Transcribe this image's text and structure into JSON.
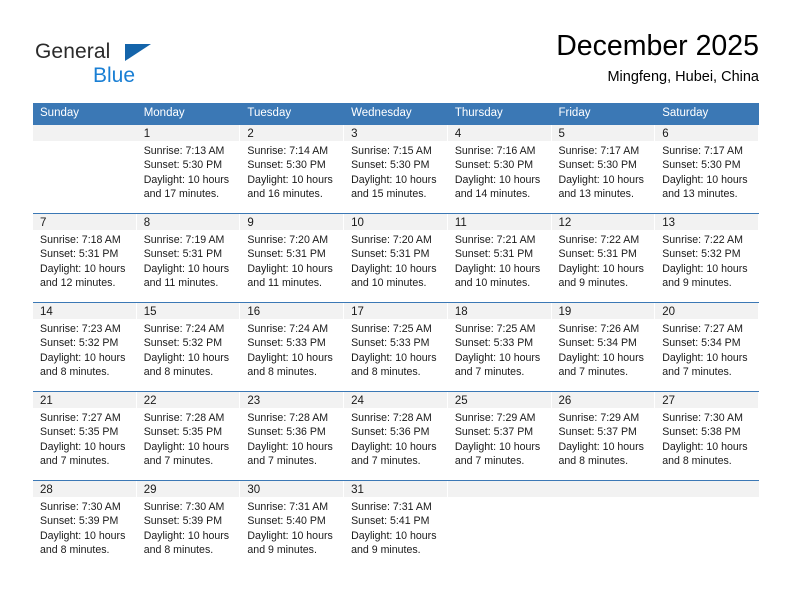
{
  "brand": {
    "name_top": "General",
    "name_bottom": "Blue",
    "accent_color": "#1a7fd4",
    "triangle_color": "#1464aa"
  },
  "header": {
    "title": "December 2025",
    "subtitle": "Mingfeng, Hubei, China"
  },
  "theme": {
    "header_row_bg": "#3b78b5",
    "daynum_band_bg": "#f2f2f2",
    "cell_bg": "#ffffff",
    "text_color": "#1a1a1a"
  },
  "calendar": {
    "daynames": [
      "Sunday",
      "Monday",
      "Tuesday",
      "Wednesday",
      "Thursday",
      "Friday",
      "Saturday"
    ],
    "weeks": [
      [
        {
          "day": "",
          "sunrise": "",
          "sunset": "",
          "daylight_1": "",
          "daylight_2": ""
        },
        {
          "day": "1",
          "sunrise": "Sunrise: 7:13 AM",
          "sunset": "Sunset: 5:30 PM",
          "daylight_1": "Daylight: 10 hours",
          "daylight_2": "and 17 minutes."
        },
        {
          "day": "2",
          "sunrise": "Sunrise: 7:14 AM",
          "sunset": "Sunset: 5:30 PM",
          "daylight_1": "Daylight: 10 hours",
          "daylight_2": "and 16 minutes."
        },
        {
          "day": "3",
          "sunrise": "Sunrise: 7:15 AM",
          "sunset": "Sunset: 5:30 PM",
          "daylight_1": "Daylight: 10 hours",
          "daylight_2": "and 15 minutes."
        },
        {
          "day": "4",
          "sunrise": "Sunrise: 7:16 AM",
          "sunset": "Sunset: 5:30 PM",
          "daylight_1": "Daylight: 10 hours",
          "daylight_2": "and 14 minutes."
        },
        {
          "day": "5",
          "sunrise": "Sunrise: 7:17 AM",
          "sunset": "Sunset: 5:30 PM",
          "daylight_1": "Daylight: 10 hours",
          "daylight_2": "and 13 minutes."
        },
        {
          "day": "6",
          "sunrise": "Sunrise: 7:17 AM",
          "sunset": "Sunset: 5:30 PM",
          "daylight_1": "Daylight: 10 hours",
          "daylight_2": "and 13 minutes."
        }
      ],
      [
        {
          "day": "7",
          "sunrise": "Sunrise: 7:18 AM",
          "sunset": "Sunset: 5:31 PM",
          "daylight_1": "Daylight: 10 hours",
          "daylight_2": "and 12 minutes."
        },
        {
          "day": "8",
          "sunrise": "Sunrise: 7:19 AM",
          "sunset": "Sunset: 5:31 PM",
          "daylight_1": "Daylight: 10 hours",
          "daylight_2": "and 11 minutes."
        },
        {
          "day": "9",
          "sunrise": "Sunrise: 7:20 AM",
          "sunset": "Sunset: 5:31 PM",
          "daylight_1": "Daylight: 10 hours",
          "daylight_2": "and 11 minutes."
        },
        {
          "day": "10",
          "sunrise": "Sunrise: 7:20 AM",
          "sunset": "Sunset: 5:31 PM",
          "daylight_1": "Daylight: 10 hours",
          "daylight_2": "and 10 minutes."
        },
        {
          "day": "11",
          "sunrise": "Sunrise: 7:21 AM",
          "sunset": "Sunset: 5:31 PM",
          "daylight_1": "Daylight: 10 hours",
          "daylight_2": "and 10 minutes."
        },
        {
          "day": "12",
          "sunrise": "Sunrise: 7:22 AM",
          "sunset": "Sunset: 5:31 PM",
          "daylight_1": "Daylight: 10 hours",
          "daylight_2": "and 9 minutes."
        },
        {
          "day": "13",
          "sunrise": "Sunrise: 7:22 AM",
          "sunset": "Sunset: 5:32 PM",
          "daylight_1": "Daylight: 10 hours",
          "daylight_2": "and 9 minutes."
        }
      ],
      [
        {
          "day": "14",
          "sunrise": "Sunrise: 7:23 AM",
          "sunset": "Sunset: 5:32 PM",
          "daylight_1": "Daylight: 10 hours",
          "daylight_2": "and 8 minutes."
        },
        {
          "day": "15",
          "sunrise": "Sunrise: 7:24 AM",
          "sunset": "Sunset: 5:32 PM",
          "daylight_1": "Daylight: 10 hours",
          "daylight_2": "and 8 minutes."
        },
        {
          "day": "16",
          "sunrise": "Sunrise: 7:24 AM",
          "sunset": "Sunset: 5:33 PM",
          "daylight_1": "Daylight: 10 hours",
          "daylight_2": "and 8 minutes."
        },
        {
          "day": "17",
          "sunrise": "Sunrise: 7:25 AM",
          "sunset": "Sunset: 5:33 PM",
          "daylight_1": "Daylight: 10 hours",
          "daylight_2": "and 8 minutes."
        },
        {
          "day": "18",
          "sunrise": "Sunrise: 7:25 AM",
          "sunset": "Sunset: 5:33 PM",
          "daylight_1": "Daylight: 10 hours",
          "daylight_2": "and 7 minutes."
        },
        {
          "day": "19",
          "sunrise": "Sunrise: 7:26 AM",
          "sunset": "Sunset: 5:34 PM",
          "daylight_1": "Daylight: 10 hours",
          "daylight_2": "and 7 minutes."
        },
        {
          "day": "20",
          "sunrise": "Sunrise: 7:27 AM",
          "sunset": "Sunset: 5:34 PM",
          "daylight_1": "Daylight: 10 hours",
          "daylight_2": "and 7 minutes."
        }
      ],
      [
        {
          "day": "21",
          "sunrise": "Sunrise: 7:27 AM",
          "sunset": "Sunset: 5:35 PM",
          "daylight_1": "Daylight: 10 hours",
          "daylight_2": "and 7 minutes."
        },
        {
          "day": "22",
          "sunrise": "Sunrise: 7:28 AM",
          "sunset": "Sunset: 5:35 PM",
          "daylight_1": "Daylight: 10 hours",
          "daylight_2": "and 7 minutes."
        },
        {
          "day": "23",
          "sunrise": "Sunrise: 7:28 AM",
          "sunset": "Sunset: 5:36 PM",
          "daylight_1": "Daylight: 10 hours",
          "daylight_2": "and 7 minutes."
        },
        {
          "day": "24",
          "sunrise": "Sunrise: 7:28 AM",
          "sunset": "Sunset: 5:36 PM",
          "daylight_1": "Daylight: 10 hours",
          "daylight_2": "and 7 minutes."
        },
        {
          "day": "25",
          "sunrise": "Sunrise: 7:29 AM",
          "sunset": "Sunset: 5:37 PM",
          "daylight_1": "Daylight: 10 hours",
          "daylight_2": "and 7 minutes."
        },
        {
          "day": "26",
          "sunrise": "Sunrise: 7:29 AM",
          "sunset": "Sunset: 5:37 PM",
          "daylight_1": "Daylight: 10 hours",
          "daylight_2": "and 8 minutes."
        },
        {
          "day": "27",
          "sunrise": "Sunrise: 7:30 AM",
          "sunset": "Sunset: 5:38 PM",
          "daylight_1": "Daylight: 10 hours",
          "daylight_2": "and 8 minutes."
        }
      ],
      [
        {
          "day": "28",
          "sunrise": "Sunrise: 7:30 AM",
          "sunset": "Sunset: 5:39 PM",
          "daylight_1": "Daylight: 10 hours",
          "daylight_2": "and 8 minutes."
        },
        {
          "day": "29",
          "sunrise": "Sunrise: 7:30 AM",
          "sunset": "Sunset: 5:39 PM",
          "daylight_1": "Daylight: 10 hours",
          "daylight_2": "and 8 minutes."
        },
        {
          "day": "30",
          "sunrise": "Sunrise: 7:31 AM",
          "sunset": "Sunset: 5:40 PM",
          "daylight_1": "Daylight: 10 hours",
          "daylight_2": "and 9 minutes."
        },
        {
          "day": "31",
          "sunrise": "Sunrise: 7:31 AM",
          "sunset": "Sunset: 5:41 PM",
          "daylight_1": "Daylight: 10 hours",
          "daylight_2": "and 9 minutes."
        },
        {
          "day": "",
          "sunrise": "",
          "sunset": "",
          "daylight_1": "",
          "daylight_2": ""
        },
        {
          "day": "",
          "sunrise": "",
          "sunset": "",
          "daylight_1": "",
          "daylight_2": ""
        },
        {
          "day": "",
          "sunrise": "",
          "sunset": "",
          "daylight_1": "",
          "daylight_2": ""
        }
      ]
    ]
  }
}
